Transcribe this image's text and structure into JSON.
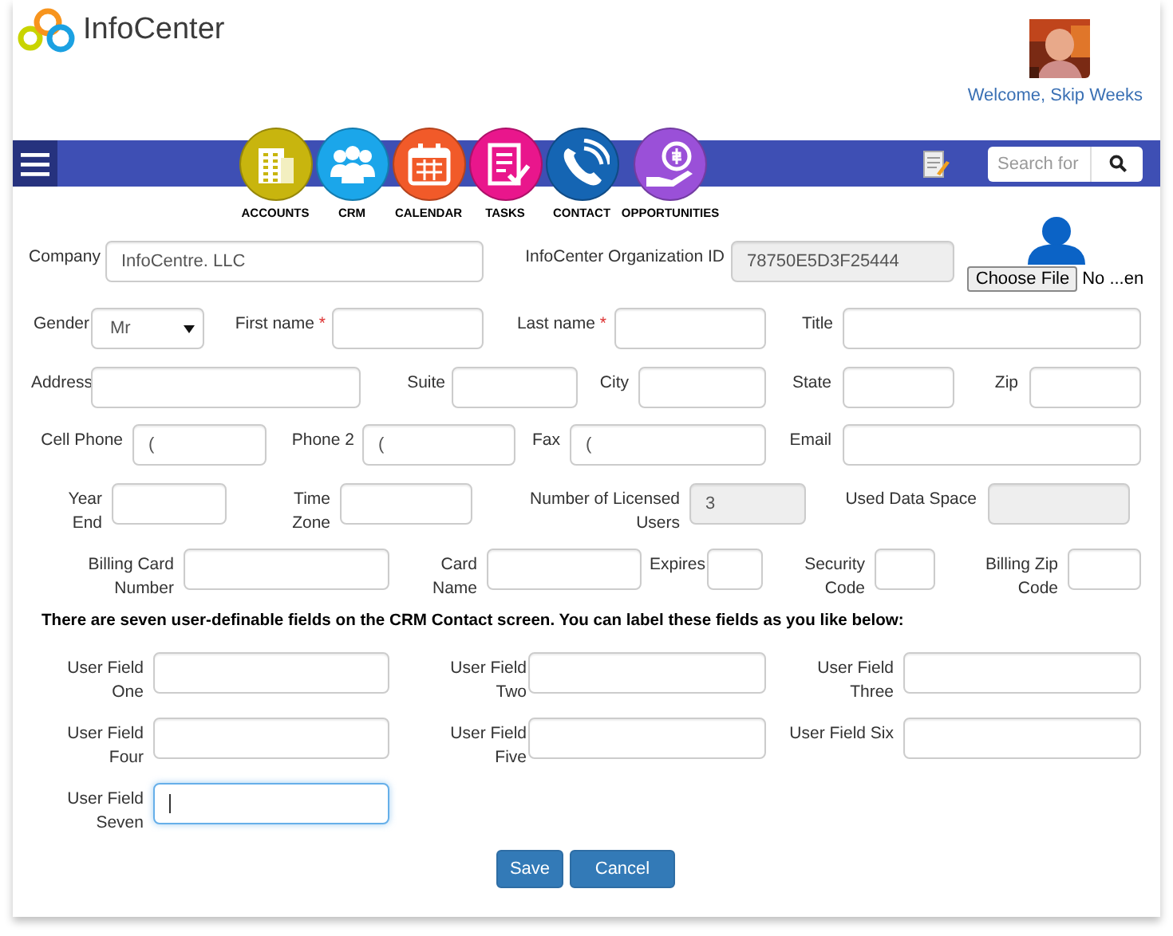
{
  "header": {
    "logo": "InfoCenter",
    "welcome": "Welcome, Skip Weeks"
  },
  "nav": {
    "modules": [
      {
        "label": "ACCOUNTS",
        "kind": "building",
        "color": "#c8b50e"
      },
      {
        "label": "CRM",
        "kind": "people",
        "color": "#1ba6ea"
      },
      {
        "label": "CALENDAR",
        "kind": "calendar",
        "color": "#f15a29"
      },
      {
        "label": "TASKS",
        "kind": "checklist",
        "color": "#e9168c"
      },
      {
        "label": "CONTACT",
        "kind": "phone",
        "color": "#1565b3"
      },
      {
        "label": "OPPORTUNITIES",
        "kind": "money",
        "color": "#9a50d8"
      }
    ],
    "search": {
      "placeholder": "Search for"
    }
  },
  "form": {
    "rows": [
      {
        "fields": [
          {
            "kind": "text",
            "label": "Company",
            "value": "InfoCentre. LLC",
            "readonly": false
          },
          {
            "kind": "text",
            "label": "InfoCenter Organization ID",
            "value": "78750E5D3F25444",
            "readonly": true
          },
          {
            "kind": "file",
            "button": "Choose File",
            "file_name": "No ...en"
          }
        ]
      },
      {
        "fields": [
          {
            "kind": "select",
            "label": "Gender",
            "value": "Mr"
          },
          {
            "kind": "text",
            "label": "First name",
            "required_mark": "*",
            "readonly": false
          },
          {
            "kind": "text",
            "label": "Last name",
            "required_mark": "*",
            "readonly": false
          },
          {
            "kind": "text",
            "label": "Title",
            "readonly": false
          }
        ]
      },
      {
        "fields": [
          {
            "kind": "text",
            "label": "Address",
            "readonly": false
          },
          {
            "kind": "text",
            "label": "Suite",
            "readonly": false
          },
          {
            "kind": "text",
            "label": "City",
            "readonly": false
          },
          {
            "kind": "text",
            "label": "State",
            "readonly": false
          },
          {
            "kind": "text",
            "label": "Zip",
            "readonly": false
          }
        ]
      },
      {
        "fields": [
          {
            "kind": "text",
            "label": "Cell Phone",
            "value": "(",
            "readonly": false
          },
          {
            "kind": "text",
            "label": "Phone 2",
            "value": "(",
            "readonly": false
          },
          {
            "kind": "text",
            "label": "Fax",
            "value": "(",
            "readonly": false
          },
          {
            "kind": "text",
            "label": "Email",
            "readonly": false
          }
        ]
      },
      {
        "fields": [
          {
            "kind": "text",
            "label": "Year End",
            "readonly": false
          },
          {
            "kind": "text",
            "label": "Time Zone",
            "readonly": false
          },
          {
            "kind": "text",
            "label": "Number of Licensed Users",
            "value": "3",
            "readonly": true
          },
          {
            "kind": "text",
            "label": "Used Data Space",
            "readonly": true
          }
        ]
      },
      {
        "fields": [
          {
            "kind": "text",
            "label": "Billing Card Number",
            "readonly": false
          },
          {
            "kind": "text",
            "label": "Card Name",
            "readonly": false
          },
          {
            "kind": "text",
            "label": "Expires",
            "readonly": false
          },
          {
            "kind": "text",
            "label": "Security Code",
            "readonly": false
          },
          {
            "kind": "text",
            "label": "Billing Zip Code",
            "readonly": false
          }
        ]
      }
    ],
    "note": "There are seven user-definable fields on the CRM Contact screen. You can label these fields as you like below:",
    "user_fields": [
      {
        "label": "User Field One",
        "focused": false
      },
      {
        "label": "User Field Two",
        "focused": false
      },
      {
        "label": "User Field Three",
        "focused": false
      },
      {
        "label": "User Field Four",
        "focused": false
      },
      {
        "label": "User Field Five",
        "focused": false
      },
      {
        "label": "User Field Six",
        "focused": false
      },
      {
        "label": "User Field Seven",
        "focused": true
      }
    ],
    "buttons": [
      "Save",
      "Cancel"
    ]
  }
}
